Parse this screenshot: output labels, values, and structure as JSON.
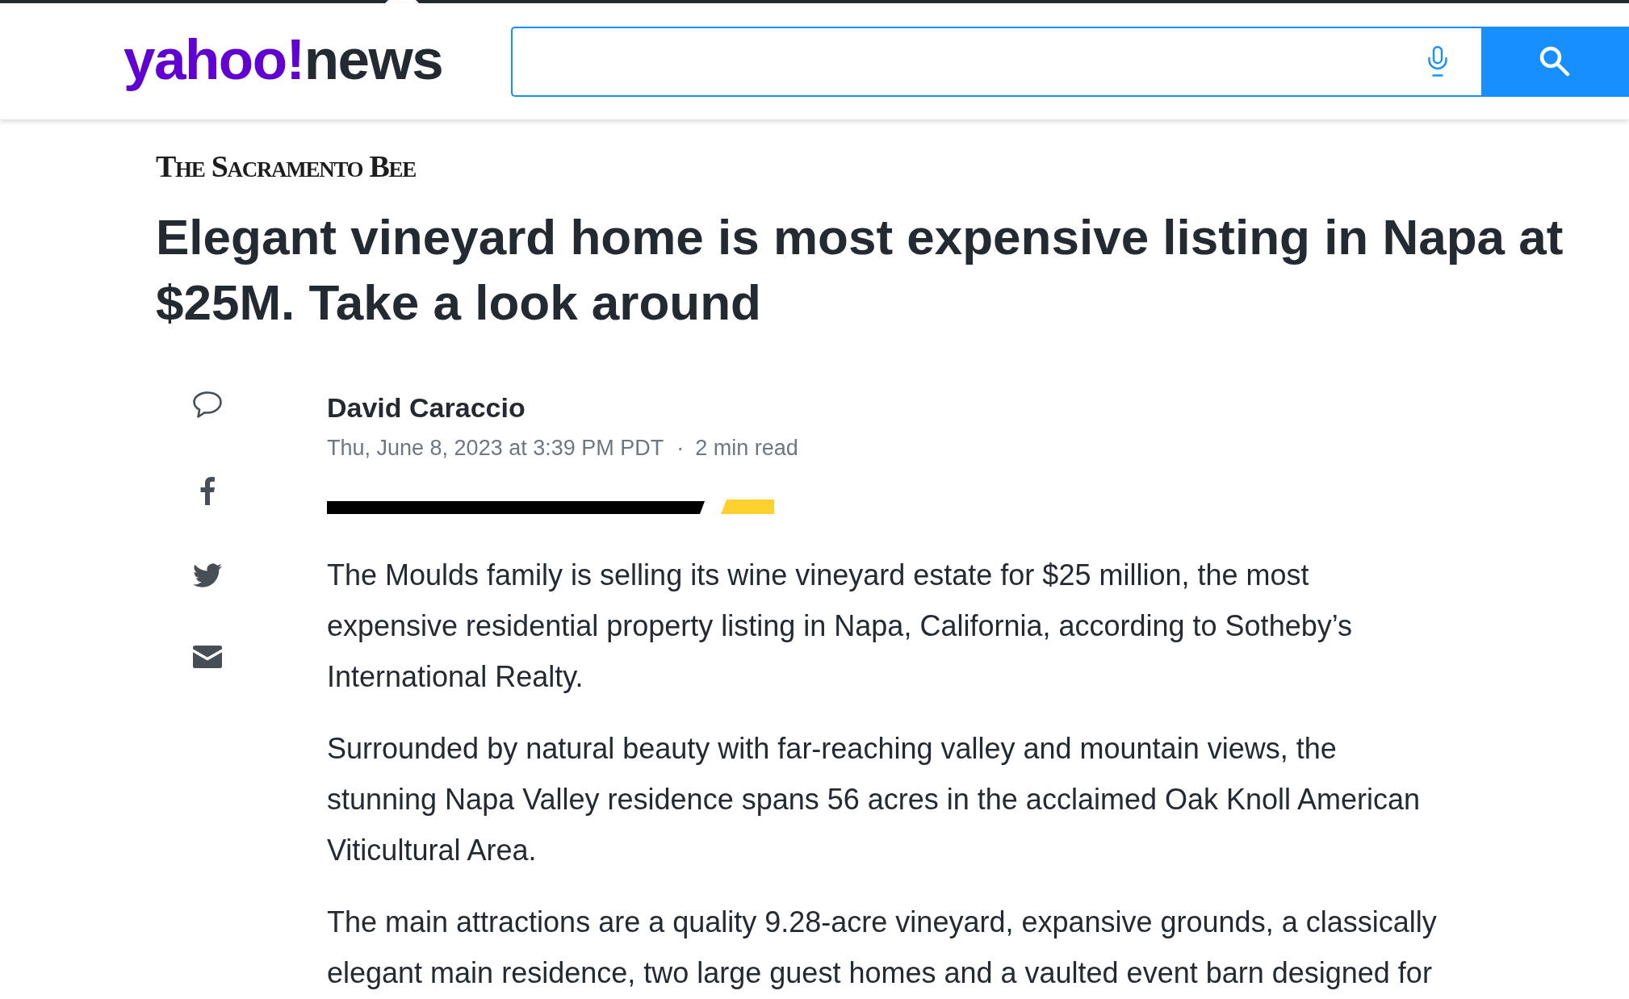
{
  "header": {
    "logo": {
      "brand": "yahoo!",
      "section": "news"
    }
  },
  "article": {
    "publisher": "The Sacramento Bee",
    "headline": "Elegant vineyard home is most expensive listing in Napa at $25M. Take a look around",
    "author": "David Caraccio",
    "date": "Thu, June 8, 2023 at 3:39 PM PDT",
    "meta_separator": "·",
    "read_time": "2 min read",
    "paragraphs": [
      "The Moulds family is selling its wine vineyard estate for $25 million, the most expensive residential property listing in Napa, California, according to Sotheby’s International Realty.",
      "Surrounded by natural beauty with far-reaching valley and mountain views, the stunning Napa Valley residence spans 56 acres in the acclaimed Oak Knoll American Viticultural Area.",
      "The main attractions are a quality 9.28-acre vineyard, expansive grounds, a classically elegant main residence, two large guest homes and a vaulted event barn designed for"
    ]
  }
}
